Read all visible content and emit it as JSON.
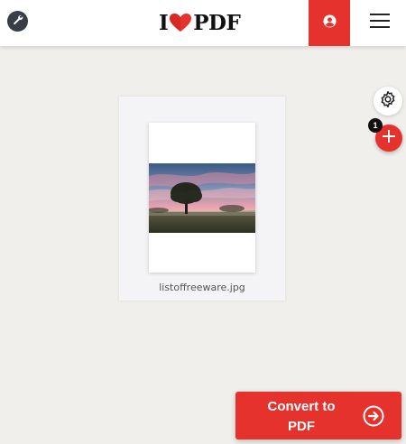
{
  "header": {
    "logo_left": "I",
    "logo_right": "PDF",
    "brand_color": "#e5322d",
    "icons": {
      "tools": "wrench-icon",
      "user": "user-icon",
      "menu": "hamburger-menu-icon"
    }
  },
  "file": {
    "name": "listoffreeware.jpg",
    "thumbnail": "landscape-photo-tree-sunset"
  },
  "side_actions": {
    "settings_icon": "gear-icon",
    "add_icon": "plus-icon",
    "file_count": "1"
  },
  "convert": {
    "line1": "Convert to",
    "line2": "PDF",
    "icon": "arrow-right-circle-icon"
  }
}
